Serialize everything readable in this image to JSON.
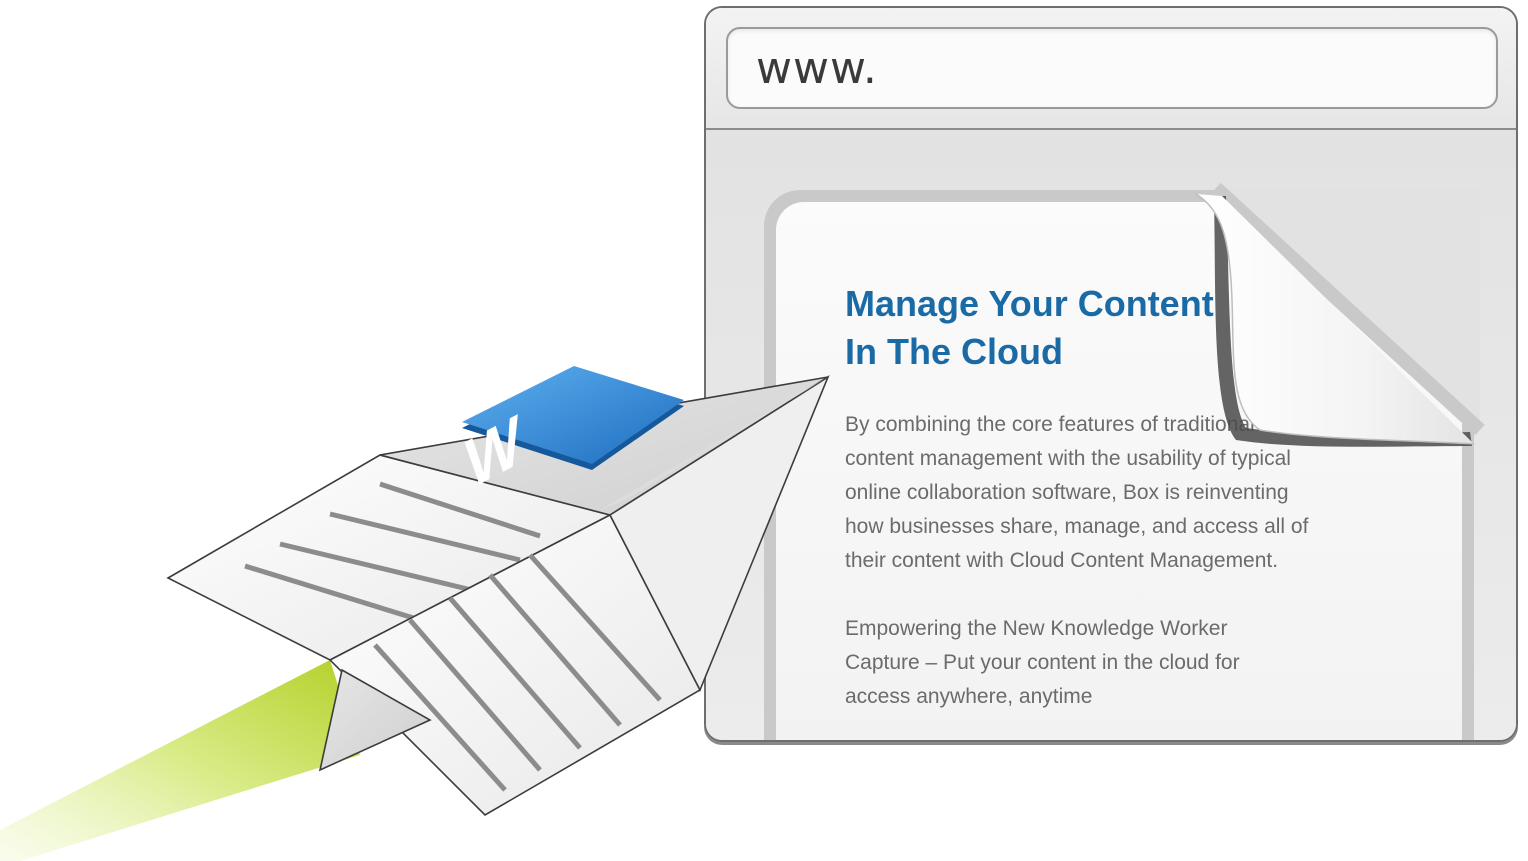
{
  "browser": {
    "url_text": "www."
  },
  "document": {
    "title_lines": [
      "Manage Your Content",
      "In The Cloud"
    ],
    "paragraph1_lines": [
      "By combining the core features of traditional",
      "content management with the usability of typical",
      "online collaboration software, Box is reinventing",
      "how businesses share, manage, and access all of",
      "their content with Cloud Content Management."
    ],
    "paragraph2_lines": [
      "Empowering the New Knowledge Worker",
      "Capture – Put your content in the cloud for",
      "access anywhere, anytime"
    ]
  },
  "icons": {
    "word_badge": "word-document-icon",
    "paper_plane": "paper-airplane-icon"
  },
  "colors": {
    "title": "#1a6aa6",
    "body_text": "#6b6b6b",
    "trail_green": "#b7d42a",
    "word_blue": "#2a7fd0"
  },
  "word_badge_letter": "W"
}
